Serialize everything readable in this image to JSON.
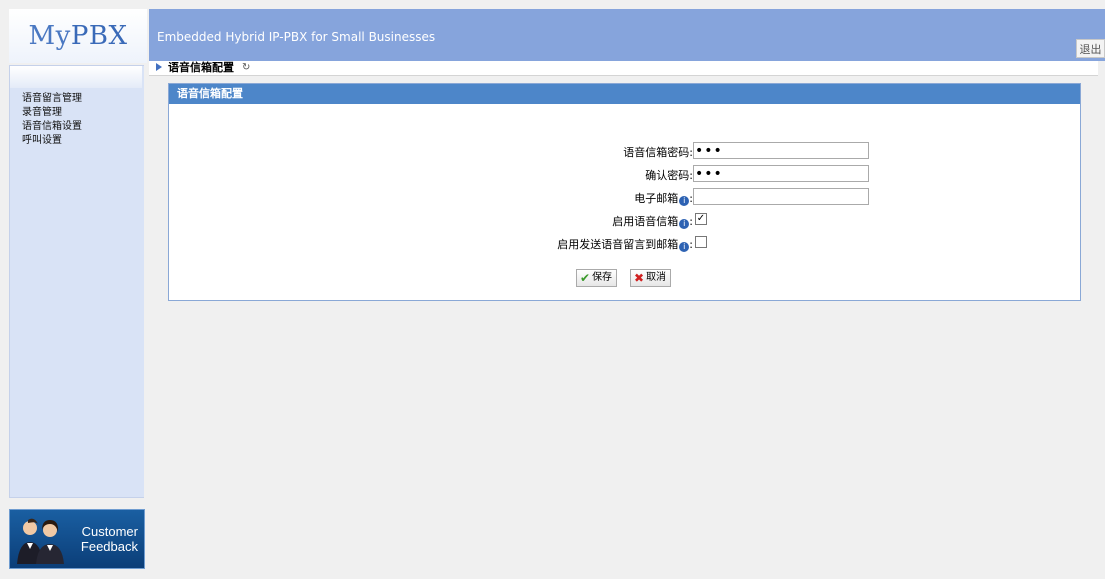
{
  "header": {
    "logo": {
      "my": "My",
      "pbx": "PBX"
    },
    "slogan": "Embedded Hybrid IP-PBX for Small Businesses",
    "logout": "退出"
  },
  "sidebar": {
    "items": [
      {
        "label": "语音留言管理"
      },
      {
        "label": "录音管理"
      },
      {
        "label": "语音信箱设置"
      },
      {
        "label": "呼叫设置"
      }
    ]
  },
  "feedback": {
    "line1": "Customer",
    "line2": "Feedback"
  },
  "breadcrumb": {
    "title": "语音信箱配置",
    "refresh_icon": "↻"
  },
  "panel": {
    "title": "语音信箱配置",
    "fields": [
      {
        "label": "语音信箱密码:",
        "value": "•••"
      },
      {
        "label": "确认密码:",
        "value": "•••"
      },
      {
        "label": "电子邮箱",
        "value": "",
        "info": true
      },
      {
        "label": "启用语音信箱",
        "checked": true,
        "info": true
      },
      {
        "label": "启用发送语音留言到邮箱",
        "checked": false,
        "info": true
      }
    ],
    "save_label": "保存",
    "cancel_label": "取消"
  },
  "colors": {
    "banner": "#86a4dc",
    "panel_head": "#4d86c9",
    "sidebar": "#d9e3f6"
  }
}
